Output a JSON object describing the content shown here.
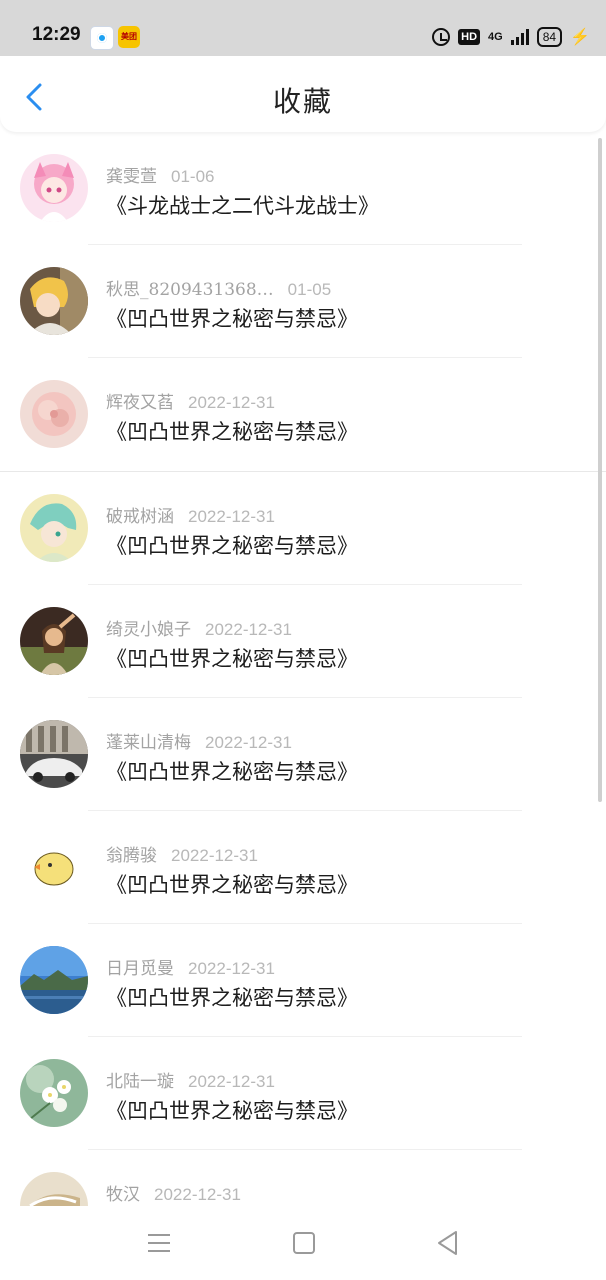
{
  "status_bar": {
    "time": "12:29",
    "app_badge_text": "美团",
    "network": "4G",
    "hd_label": "HD",
    "battery": "84"
  },
  "header": {
    "title": "收藏"
  },
  "favorites": [
    {
      "user": "龚雯萱",
      "date": "01-06",
      "book": "《斗龙战士之二代斗龙战士》",
      "avatar": "pink-anime-girl"
    },
    {
      "user": "秋思_8209431368…",
      "date": "01-05",
      "book": "《凹凸世界之秘密与禁忌》",
      "avatar": "blonde-anime-character"
    },
    {
      "user": "辉夜又萏",
      "date": "2022-12-31",
      "book": "《凹凸世界之秘密与禁忌》",
      "avatar": "pink-flower"
    },
    {
      "user": "破戒树涵",
      "date": "2022-12-31",
      "book": "《凹凸世界之秘密与禁忌》",
      "avatar": "teal-hair-anime-boy"
    },
    {
      "user": "绮灵小娘子",
      "date": "2022-12-31",
      "book": "《凹凸世界之秘密与禁忌》",
      "avatar": "girl-portrait"
    },
    {
      "user": "蓬莱山清梅",
      "date": "2022-12-31",
      "book": "《凹凸世界之秘密与禁忌》",
      "avatar": "white-car"
    },
    {
      "user": "翁腾骏",
      "date": "2022-12-31",
      "book": "《凹凸世界之秘密与禁忌》",
      "avatar": "yellow-chick"
    },
    {
      "user": "日月觅曼",
      "date": "2022-12-31",
      "book": "《凹凸世界之秘密与禁忌》",
      "avatar": "lake-landscape"
    },
    {
      "user": "北陆一璇",
      "date": "2022-12-31",
      "book": "《凹凸世界之秘密与禁忌》",
      "avatar": "white-blossoms"
    },
    {
      "user": "牧汉",
      "date": "2022-12-31",
      "book": "",
      "avatar": "beige-photo"
    }
  ],
  "colors": {
    "accent": "#2b8ef0",
    "status_bar_bg": "#d8d8d8",
    "meta_text": "#a3a3a3",
    "title_text": "#1d1d1d"
  }
}
